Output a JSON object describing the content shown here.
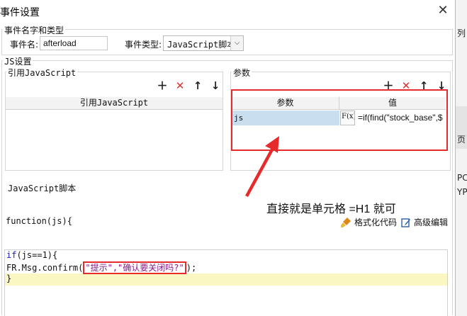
{
  "dialog": {
    "title": "事件设置",
    "close_glyph": "✕"
  },
  "event_group": {
    "legend": "事件名字和类型",
    "name_label": "事件名:",
    "name_value": "afterload",
    "type_label": "事件类型:",
    "type_value": "JavaScript脚本"
  },
  "js_group": {
    "legend": "JS设置",
    "ref_legend": "引用JavaScript",
    "ref_header": "引用JavaScript",
    "params_legend": "参数",
    "params_header_param": "参数",
    "params_header_value": "值",
    "param_row_name": "js",
    "param_fx": "F(x)",
    "param_row_value": "=if(find(\"stock_base\",$"
  },
  "script_group": {
    "legend": "JavaScript脚本",
    "function_header": "function(js){",
    "format_code": "格式化代码",
    "advanced_edit": "高级编辑",
    "code": {
      "line1_kw": "if",
      "line1_rest": "(js==1){",
      "line2_pre": "FR.Msg.confirm(",
      "line2_str": "\"提示\",\"确认要关闭吗?\"",
      "line2_post": ");",
      "line3": "}"
    }
  },
  "annotation": {
    "text": "直接就是单元格  =H1  就可"
  },
  "background_window": {
    "frag_top": "列",
    "frag_mid": "页 实",
    "frag_p": "PC",
    "frag_yp": "YP"
  },
  "colors": {
    "accent_red": "#e52b2b",
    "selected_cell": "#c9dff0",
    "code_highlight": "#fbf7c2"
  }
}
